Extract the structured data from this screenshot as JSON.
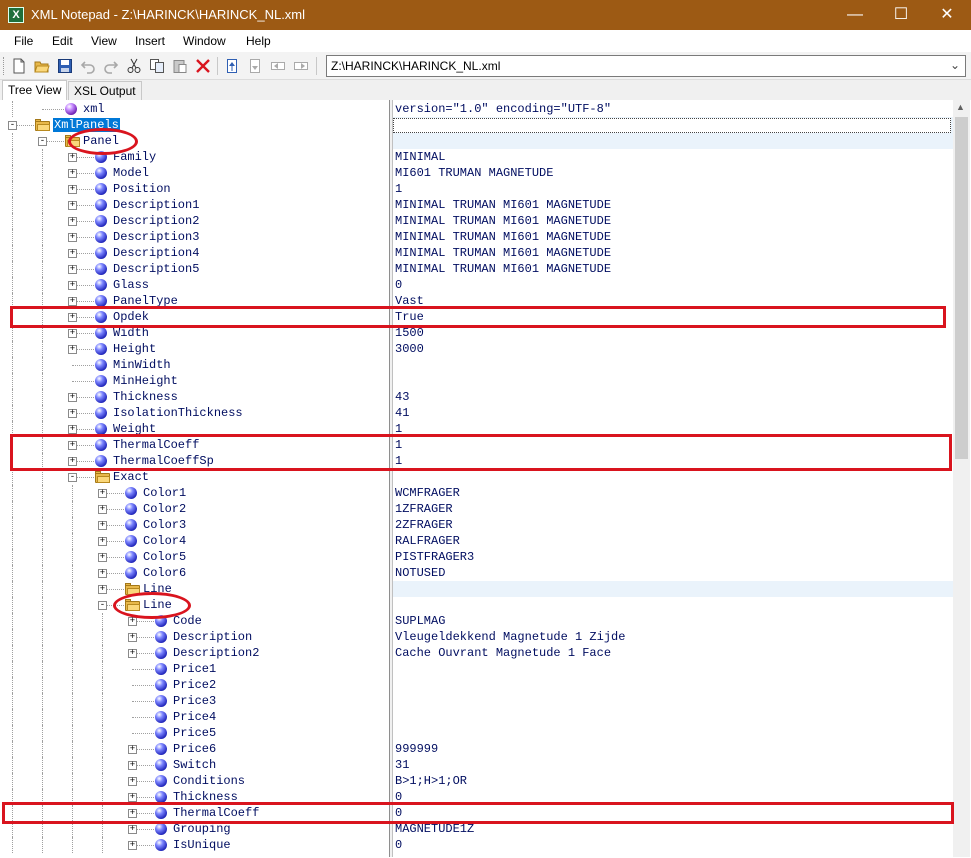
{
  "window": {
    "title": "XML Notepad - Z:\\HARINCK\\HARINCK_NL.xml",
    "app_icon_letter": "X",
    "minimize": "—",
    "maximize": "☐",
    "close": "✕"
  },
  "menu": [
    "File",
    "Edit",
    "View",
    "Insert",
    "Window",
    "Help"
  ],
  "toolbar": {
    "icons": [
      "new-document-icon",
      "open-folder-icon",
      "save-icon",
      "undo-icon",
      "redo-icon",
      "cut-icon",
      "copy-icon",
      "paste-icon",
      "delete-icon",
      "nudge-up-icon",
      "nudge-down-icon",
      "nudge-left-icon",
      "nudge-right-icon"
    ],
    "path_value": "Z:\\HARINCK\\HARINCK_NL.xml",
    "path_dropdown_arrow": "⌄"
  },
  "tabs": [
    {
      "label": "Tree View",
      "active": true
    },
    {
      "label": "XSL Output",
      "active": false
    }
  ],
  "tree": [
    {
      "label": "xml",
      "value": "version=\"1.0\" encoding=\"UTF-8\"",
      "depth": 1,
      "type": "pi",
      "toggle": ""
    },
    {
      "label": "XmlPanels",
      "value": "",
      "depth": 0,
      "type": "folder",
      "toggle": "-",
      "selected": true
    },
    {
      "label": "Panel",
      "value": "",
      "depth": 1,
      "type": "folder",
      "toggle": "-"
    },
    {
      "label": "Family",
      "value": "MINIMAL",
      "depth": 2,
      "type": "element",
      "toggle": "+"
    },
    {
      "label": "Model",
      "value": "MI601 TRUMAN MAGNETUDE",
      "depth": 2,
      "type": "element",
      "toggle": "+"
    },
    {
      "label": "Position",
      "value": "1",
      "depth": 2,
      "type": "element",
      "toggle": "+"
    },
    {
      "label": "Description1",
      "value": "MINIMAL TRUMAN MI601 MAGNETUDE",
      "depth": 2,
      "type": "element",
      "toggle": "+"
    },
    {
      "label": "Description2",
      "value": "MINIMAL TRUMAN MI601 MAGNETUDE",
      "depth": 2,
      "type": "element",
      "toggle": "+"
    },
    {
      "label": "Description3",
      "value": "MINIMAL TRUMAN MI601 MAGNETUDE",
      "depth": 2,
      "type": "element",
      "toggle": "+"
    },
    {
      "label": "Description4",
      "value": "MINIMAL TRUMAN MI601 MAGNETUDE",
      "depth": 2,
      "type": "element",
      "toggle": "+"
    },
    {
      "label": "Description5",
      "value": "MINIMAL TRUMAN MI601 MAGNETUDE",
      "depth": 2,
      "type": "element",
      "toggle": "+"
    },
    {
      "label": "Glass",
      "value": "0",
      "depth": 2,
      "type": "element",
      "toggle": "+"
    },
    {
      "label": "PanelType",
      "value": "Vast",
      "depth": 2,
      "type": "element",
      "toggle": "+"
    },
    {
      "label": "Opdek",
      "value": "True",
      "depth": 2,
      "type": "element",
      "toggle": "+"
    },
    {
      "label": "Width",
      "value": "1500",
      "depth": 2,
      "type": "element",
      "toggle": "+"
    },
    {
      "label": "Height",
      "value": "3000",
      "depth": 2,
      "type": "element",
      "toggle": "+"
    },
    {
      "label": "MinWidth",
      "value": "",
      "depth": 2,
      "type": "element",
      "toggle": ""
    },
    {
      "label": "MinHeight",
      "value": "",
      "depth": 2,
      "type": "element",
      "toggle": ""
    },
    {
      "label": "Thickness",
      "value": "43",
      "depth": 2,
      "type": "element",
      "toggle": "+"
    },
    {
      "label": "IsolationThickness",
      "value": "41",
      "depth": 2,
      "type": "element",
      "toggle": "+"
    },
    {
      "label": "Weight",
      "value": "1",
      "depth": 2,
      "type": "element",
      "toggle": "+"
    },
    {
      "label": "ThermalCoeff",
      "value": "1",
      "depth": 2,
      "type": "element",
      "toggle": "+"
    },
    {
      "label": "ThermalCoeffSp",
      "value": "1",
      "depth": 2,
      "type": "element",
      "toggle": "+"
    },
    {
      "label": "Exact",
      "value": "",
      "depth": 2,
      "type": "folder",
      "toggle": "-"
    },
    {
      "label": "Color1",
      "value": "WCMFRAGER",
      "depth": 3,
      "type": "element",
      "toggle": "+"
    },
    {
      "label": "Color2",
      "value": "1ZFRAGER",
      "depth": 3,
      "type": "element",
      "toggle": "+"
    },
    {
      "label": "Color3",
      "value": "2ZFRAGER",
      "depth": 3,
      "type": "element",
      "toggle": "+"
    },
    {
      "label": "Color4",
      "value": "RALFRAGER",
      "depth": 3,
      "type": "element",
      "toggle": "+"
    },
    {
      "label": "Color5",
      "value": "PISTFRAGER3",
      "depth": 3,
      "type": "element",
      "toggle": "+"
    },
    {
      "label": "Color6",
      "value": "NOTUSED",
      "depth": 3,
      "type": "element",
      "toggle": "+"
    },
    {
      "label": "Line",
      "value": "",
      "depth": 3,
      "type": "folder",
      "toggle": "+"
    },
    {
      "label": "Line",
      "value": "",
      "depth": 3,
      "type": "folder",
      "toggle": "-"
    },
    {
      "label": "Code",
      "value": "SUPLMAG",
      "depth": 4,
      "type": "element",
      "toggle": "+"
    },
    {
      "label": "Description",
      "value": "Vleugeldekkend Magnetude 1 Zijde",
      "depth": 4,
      "type": "element",
      "toggle": "+"
    },
    {
      "label": "Description2",
      "value": "Cache Ouvrant Magnetude 1 Face",
      "depth": 4,
      "type": "element",
      "toggle": "+"
    },
    {
      "label": "Price1",
      "value": "",
      "depth": 4,
      "type": "element",
      "toggle": ""
    },
    {
      "label": "Price2",
      "value": "",
      "depth": 4,
      "type": "element",
      "toggle": ""
    },
    {
      "label": "Price3",
      "value": "",
      "depth": 4,
      "type": "element",
      "toggle": ""
    },
    {
      "label": "Price4",
      "value": "",
      "depth": 4,
      "type": "element",
      "toggle": ""
    },
    {
      "label": "Price5",
      "value": "",
      "depth": 4,
      "type": "element",
      "toggle": ""
    },
    {
      "label": "Price6",
      "value": "999999",
      "depth": 4,
      "type": "element",
      "toggle": "+"
    },
    {
      "label": "Switch",
      "value": "31",
      "depth": 4,
      "type": "element",
      "toggle": "+"
    },
    {
      "label": "Conditions",
      "value": "B>1;H>1;OR",
      "depth": 4,
      "type": "element",
      "toggle": "+"
    },
    {
      "label": "Thickness",
      "value": "0",
      "depth": 4,
      "type": "element",
      "toggle": "+"
    },
    {
      "label": "ThermalCoeff",
      "value": "0",
      "depth": 4,
      "type": "element",
      "toggle": "+"
    },
    {
      "label": "Grouping",
      "value": "MAGNETUDE1Z",
      "depth": 4,
      "type": "element",
      "toggle": "+"
    },
    {
      "label": "IsUnique",
      "value": "0",
      "depth": 4,
      "type": "element",
      "toggle": "+"
    }
  ],
  "colors": {
    "titlebar": "#9d5a14",
    "highlight": "#d9141e",
    "selection": "#0078d7",
    "text": "#000d60"
  }
}
